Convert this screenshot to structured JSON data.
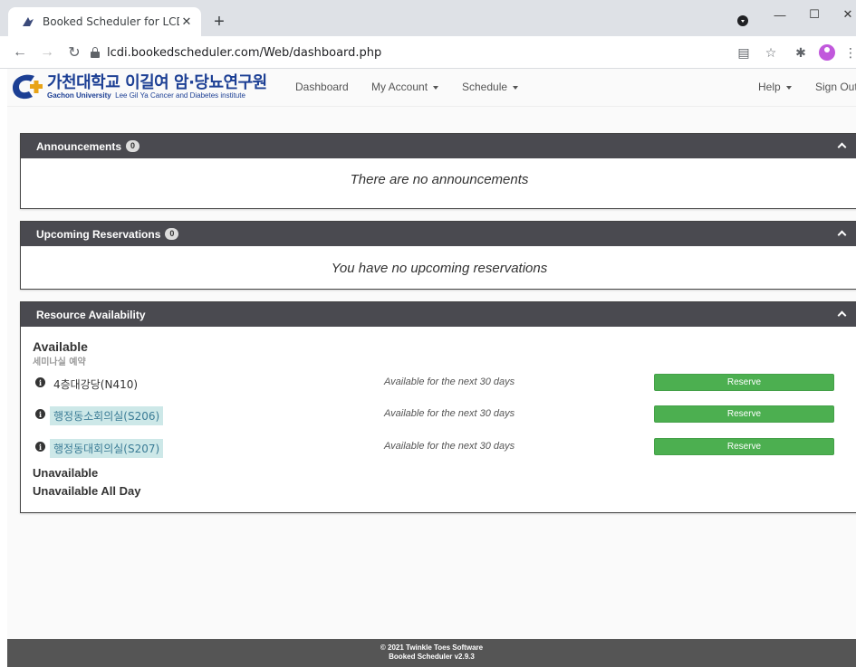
{
  "browser": {
    "tab_title": "Booked Scheduler for LCDI - My",
    "url": "lcdi.bookedscheduler.com/Web/dashboard.php"
  },
  "header": {
    "logo_korean": "가천대학교 이길여 암·당뇨연구원",
    "logo_english_bold": "Gachon University",
    "logo_english_rest": "Lee Gil Ya Cancer and Diabetes institute",
    "nav": {
      "dashboard": "Dashboard",
      "my_account": "My Account",
      "schedule": "Schedule",
      "help": "Help",
      "sign_out": "Sign Out"
    }
  },
  "announcements": {
    "title": "Announcements",
    "count": "0",
    "empty_text": "There are no announcements"
  },
  "upcoming": {
    "title": "Upcoming Reservations",
    "count": "0",
    "empty_text": "You have no upcoming reservations"
  },
  "availability": {
    "title": "Resource Availability",
    "available_label": "Available",
    "group_name": "세미나실 예약",
    "resources": [
      {
        "name": "4층대강당(N410)",
        "status": "Available for the next 30 days",
        "button": "Reserve"
      },
      {
        "name": "행정동소회의실(S206)",
        "status": "Available for the next 30 days",
        "button": "Reserve"
      },
      {
        "name": "행정동대회의실(S207)",
        "status": "Available for the next 30 days",
        "button": "Reserve"
      }
    ],
    "unavailable_label": "Unavailable",
    "unavailable_all_day_label": "Unavailable All Day"
  },
  "footer": {
    "copyright": "© 2021 Twinkle Toes Software",
    "version": "Booked Scheduler v2.9.3"
  },
  "colors": {
    "panel_header": "#4a4a50",
    "reserve_button": "#4caf50",
    "logo_blue": "#1c3f94"
  }
}
